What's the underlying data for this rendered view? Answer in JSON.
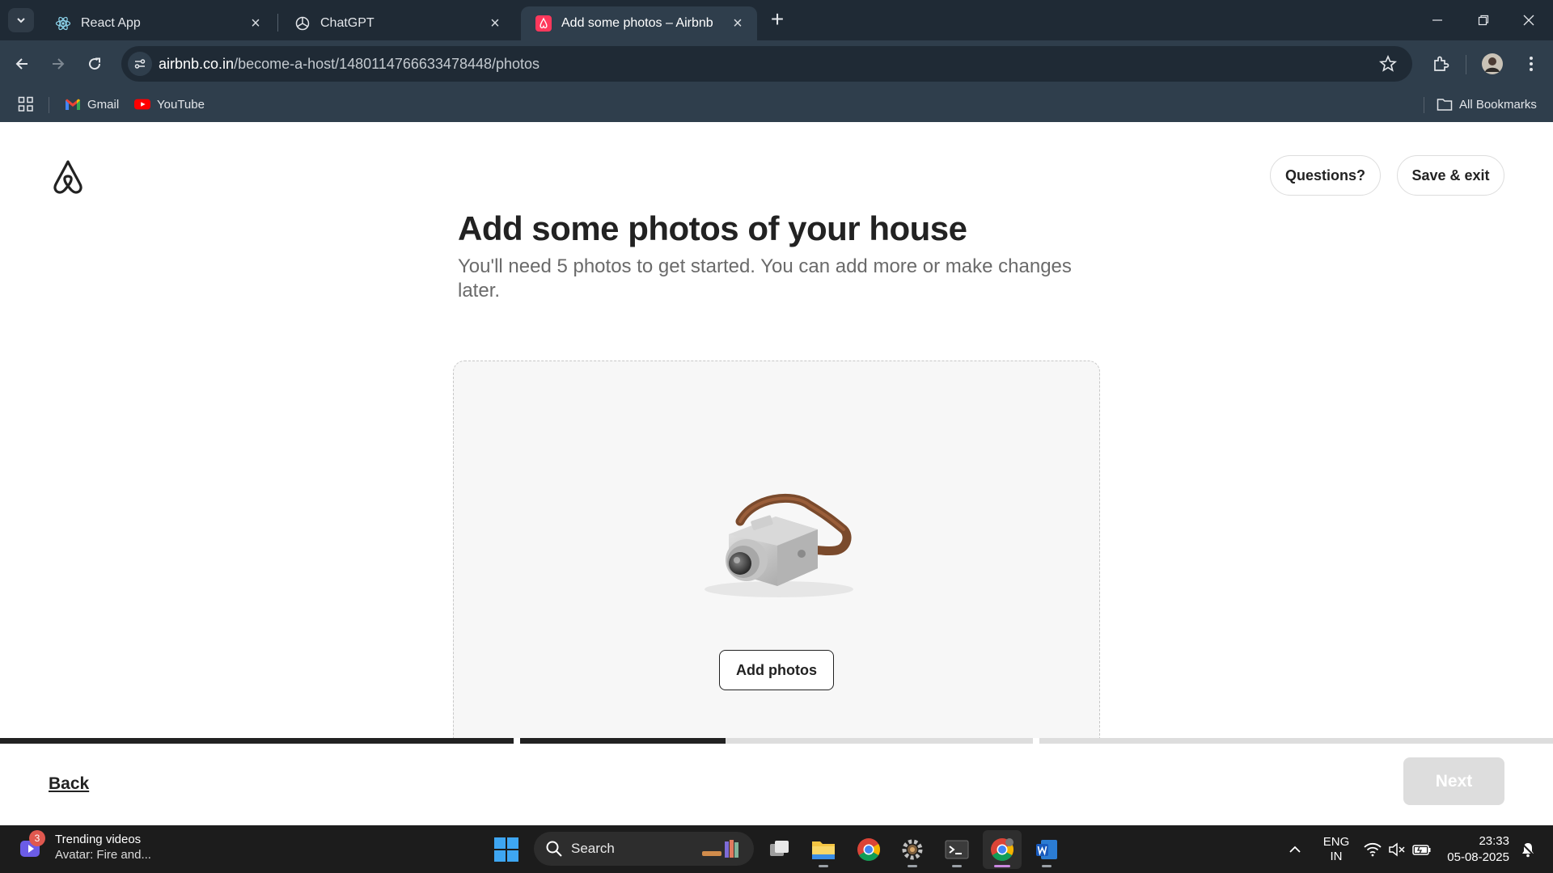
{
  "browser": {
    "tabs": [
      {
        "title": "React App",
        "icon": "react-icon",
        "active": false
      },
      {
        "title": "ChatGPT",
        "icon": "chatgpt-icon",
        "active": false
      },
      {
        "title": "Add some photos – Airbnb",
        "icon": "airbnb-icon",
        "active": true
      }
    ],
    "url_host": "airbnb.co.in",
    "url_path": "/become-a-host/1480114766633478448/photos",
    "bookmarks": [
      {
        "label": "Gmail",
        "icon": "gmail-icon"
      },
      {
        "label": "YouTube",
        "icon": "youtube-icon"
      }
    ],
    "all_bookmarks_label": "All Bookmarks"
  },
  "page": {
    "questions_label": "Questions?",
    "save_exit_label": "Save & exit",
    "title": "Add some photos of your house",
    "subtitle": "You'll need 5 photos to get started. You can add more or make changes later.",
    "add_photos_label": "Add photos",
    "back_label": "Back",
    "next_label": "Next",
    "progress_segments": [
      1.0,
      0.4,
      0.0,
      0.0
    ],
    "colors": {
      "text": "#222222",
      "muted": "#6a6a6a",
      "disabled": "#dddddd",
      "brand": "#ff385c"
    }
  },
  "taskbar": {
    "widget_badge": "3",
    "widget_title": "Trending videos",
    "widget_subtitle": "Avatar: Fire and...",
    "search_label": "Search",
    "lang_top": "ENG",
    "lang_bottom": "IN",
    "time": "23:33",
    "date": "05-08-2025"
  }
}
